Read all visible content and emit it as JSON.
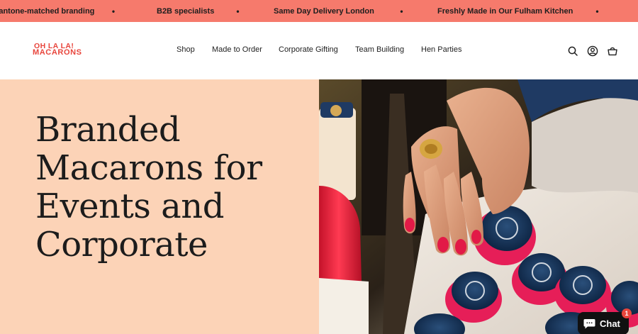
{
  "announcement": {
    "items": [
      "Pantone-matched branding",
      "B2B specialists",
      "Same Day Delivery London",
      "Freshly Made in Our Fulham Kitchen"
    ],
    "separator": "•"
  },
  "header": {
    "logo_line1": "OH LA LA!",
    "logo_line2": "MACARONS",
    "nav": [
      "Shop",
      "Made to Order",
      "Corporate Gifting",
      "Team Building",
      "Hen Parties"
    ],
    "icons": [
      "search-icon",
      "account-icon",
      "cart-icon"
    ]
  },
  "hero": {
    "title": "Branded Macarons for Events and Corporate"
  },
  "chat": {
    "label": "Chat",
    "badge": "1"
  },
  "colors": {
    "announcement_bg": "#f67a6c",
    "hero_bg": "#fcd3b7",
    "logo": "#e8453c",
    "chat_bg": "#111111"
  }
}
